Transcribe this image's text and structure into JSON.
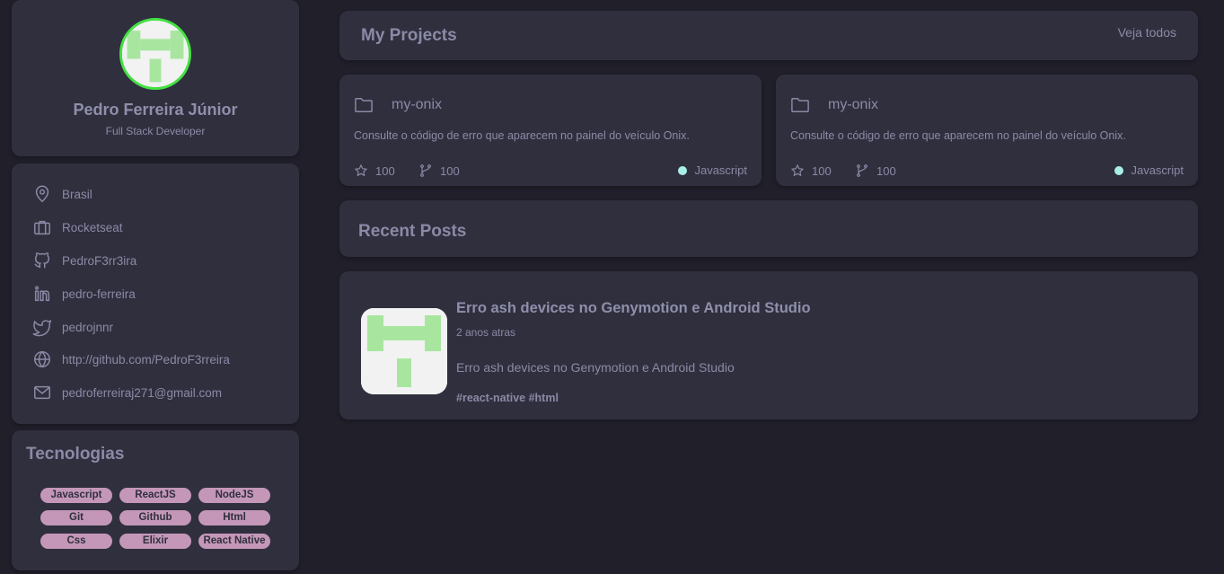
{
  "profile": {
    "name": "Pedro Ferreira Júnior",
    "role": "Full Stack Developer"
  },
  "info": {
    "items": [
      {
        "icon": "location-pin-icon",
        "label": "Brasil"
      },
      {
        "icon": "briefcase-icon",
        "label": "Rocketseat"
      },
      {
        "icon": "github-icon",
        "label": "PedroF3rr3ira"
      },
      {
        "icon": "linkedin-icon",
        "label": "pedro-ferreira"
      },
      {
        "icon": "twitter-icon",
        "label": "pedrojnnr"
      },
      {
        "icon": "globe-icon",
        "label": "http://github.com/PedroF3rreira"
      },
      {
        "icon": "mail-icon",
        "label": "pedroferreiraj271@gmail.com"
      }
    ]
  },
  "technologies": {
    "title": "Tecnologias",
    "tags": [
      "Javascript",
      "ReactJS",
      "NodeJS",
      "Git",
      "Github",
      "Html",
      "Css",
      "Elixir",
      "React Native"
    ]
  },
  "projects": {
    "title": "My Projects",
    "view_all": "Veja todos",
    "items": [
      {
        "name": "my-onix",
        "description": "Consulte o código de erro que aparecem no painel do veículo Onix.",
        "stars": "100",
        "forks": "100",
        "language": "Javascript",
        "language_color": "#a8efe8"
      },
      {
        "name": "my-onix",
        "description": "Consulte o código de erro que aparecem no painel do veículo Onix.",
        "stars": "100",
        "forks": "100",
        "language": "Javascript",
        "language_color": "#a8efe8"
      }
    ]
  },
  "posts": {
    "title": "Recent Posts",
    "items": [
      {
        "title": "Erro ash devices no Genymotion e Android Studio",
        "date": "2 anos atras",
        "body": "Erro ash devices no Genymotion e Android Studio",
        "tags": "#react-native #html"
      }
    ]
  },
  "colors": {
    "background": "#201f2a",
    "card": "#302f3e",
    "text": "#8a8aa6",
    "tag": "#c497b8",
    "avatar_ring": "#45e043",
    "avatar_glyph": "#a8e6a0"
  }
}
